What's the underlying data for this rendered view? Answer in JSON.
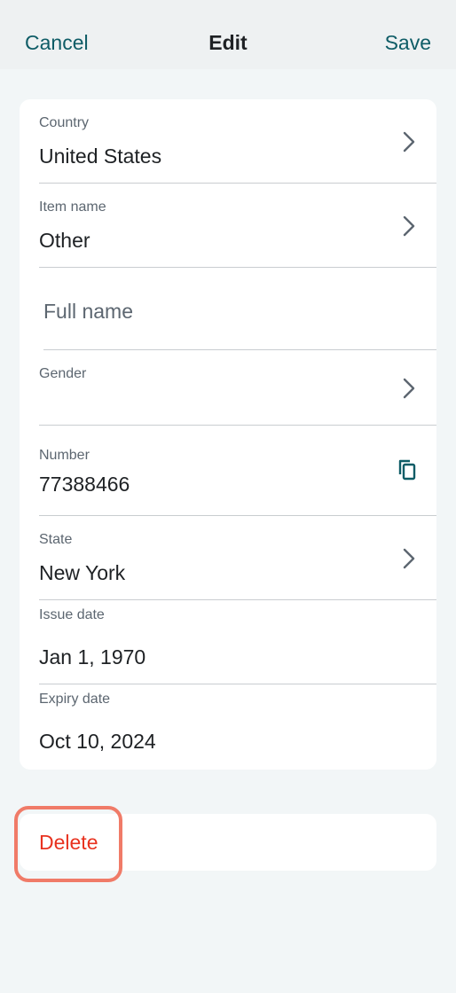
{
  "nav": {
    "cancel_label": "Cancel",
    "title": "Edit",
    "save_label": "Save"
  },
  "fields": {
    "country": {
      "label": "Country",
      "value": "United States"
    },
    "item_name": {
      "label": "Item name",
      "value": "Other"
    },
    "full_name": {
      "placeholder": "Full name",
      "value": ""
    },
    "gender": {
      "label": "Gender",
      "value": ""
    },
    "number": {
      "label": "Number",
      "value": "77388466"
    },
    "state": {
      "label": "State",
      "value": "New York"
    },
    "issue_date": {
      "label": "Issue date",
      "value": "Jan 1, 1970"
    },
    "expiry_date": {
      "label": "Expiry date",
      "value": "Oct 10, 2024"
    }
  },
  "actions": {
    "delete_label": "Delete"
  },
  "colors": {
    "accent": "#0e5c66",
    "danger": "#e8321f",
    "highlight": "#f07b68",
    "background": "#f2f6f7"
  }
}
